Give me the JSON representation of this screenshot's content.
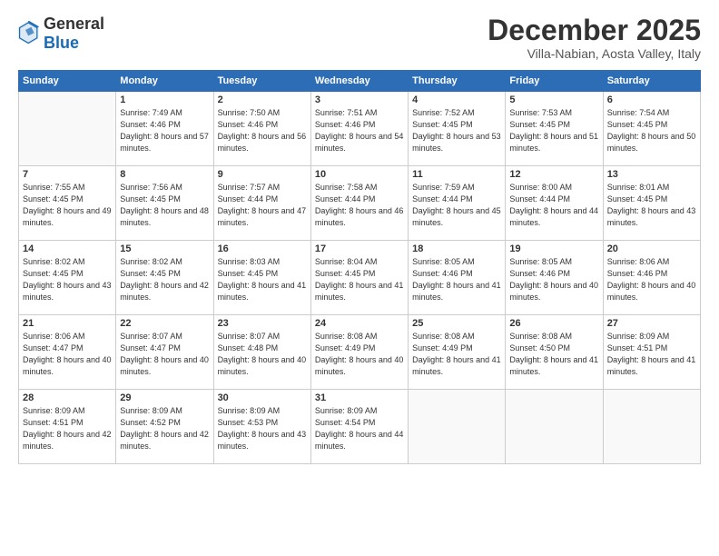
{
  "header": {
    "logo_general": "General",
    "logo_blue": "Blue",
    "month_title": "December 2025",
    "subtitle": "Villa-Nabian, Aosta Valley, Italy"
  },
  "days_of_week": [
    "Sunday",
    "Monday",
    "Tuesday",
    "Wednesday",
    "Thursday",
    "Friday",
    "Saturday"
  ],
  "weeks": [
    [
      {
        "day": "",
        "sunrise": "",
        "sunset": "",
        "daylight": ""
      },
      {
        "day": "1",
        "sunrise": "Sunrise: 7:49 AM",
        "sunset": "Sunset: 4:46 PM",
        "daylight": "Daylight: 8 hours and 57 minutes."
      },
      {
        "day": "2",
        "sunrise": "Sunrise: 7:50 AM",
        "sunset": "Sunset: 4:46 PM",
        "daylight": "Daylight: 8 hours and 56 minutes."
      },
      {
        "day": "3",
        "sunrise": "Sunrise: 7:51 AM",
        "sunset": "Sunset: 4:46 PM",
        "daylight": "Daylight: 8 hours and 54 minutes."
      },
      {
        "day": "4",
        "sunrise": "Sunrise: 7:52 AM",
        "sunset": "Sunset: 4:45 PM",
        "daylight": "Daylight: 8 hours and 53 minutes."
      },
      {
        "day": "5",
        "sunrise": "Sunrise: 7:53 AM",
        "sunset": "Sunset: 4:45 PM",
        "daylight": "Daylight: 8 hours and 51 minutes."
      },
      {
        "day": "6",
        "sunrise": "Sunrise: 7:54 AM",
        "sunset": "Sunset: 4:45 PM",
        "daylight": "Daylight: 8 hours and 50 minutes."
      }
    ],
    [
      {
        "day": "7",
        "sunrise": "Sunrise: 7:55 AM",
        "sunset": "Sunset: 4:45 PM",
        "daylight": "Daylight: 8 hours and 49 minutes."
      },
      {
        "day": "8",
        "sunrise": "Sunrise: 7:56 AM",
        "sunset": "Sunset: 4:45 PM",
        "daylight": "Daylight: 8 hours and 48 minutes."
      },
      {
        "day": "9",
        "sunrise": "Sunrise: 7:57 AM",
        "sunset": "Sunset: 4:44 PM",
        "daylight": "Daylight: 8 hours and 47 minutes."
      },
      {
        "day": "10",
        "sunrise": "Sunrise: 7:58 AM",
        "sunset": "Sunset: 4:44 PM",
        "daylight": "Daylight: 8 hours and 46 minutes."
      },
      {
        "day": "11",
        "sunrise": "Sunrise: 7:59 AM",
        "sunset": "Sunset: 4:44 PM",
        "daylight": "Daylight: 8 hours and 45 minutes."
      },
      {
        "day": "12",
        "sunrise": "Sunrise: 8:00 AM",
        "sunset": "Sunset: 4:44 PM",
        "daylight": "Daylight: 8 hours and 44 minutes."
      },
      {
        "day": "13",
        "sunrise": "Sunrise: 8:01 AM",
        "sunset": "Sunset: 4:45 PM",
        "daylight": "Daylight: 8 hours and 43 minutes."
      }
    ],
    [
      {
        "day": "14",
        "sunrise": "Sunrise: 8:02 AM",
        "sunset": "Sunset: 4:45 PM",
        "daylight": "Daylight: 8 hours and 43 minutes."
      },
      {
        "day": "15",
        "sunrise": "Sunrise: 8:02 AM",
        "sunset": "Sunset: 4:45 PM",
        "daylight": "Daylight: 8 hours and 42 minutes."
      },
      {
        "day": "16",
        "sunrise": "Sunrise: 8:03 AM",
        "sunset": "Sunset: 4:45 PM",
        "daylight": "Daylight: 8 hours and 41 minutes."
      },
      {
        "day": "17",
        "sunrise": "Sunrise: 8:04 AM",
        "sunset": "Sunset: 4:45 PM",
        "daylight": "Daylight: 8 hours and 41 minutes."
      },
      {
        "day": "18",
        "sunrise": "Sunrise: 8:05 AM",
        "sunset": "Sunset: 4:46 PM",
        "daylight": "Daylight: 8 hours and 41 minutes."
      },
      {
        "day": "19",
        "sunrise": "Sunrise: 8:05 AM",
        "sunset": "Sunset: 4:46 PM",
        "daylight": "Daylight: 8 hours and 40 minutes."
      },
      {
        "day": "20",
        "sunrise": "Sunrise: 8:06 AM",
        "sunset": "Sunset: 4:46 PM",
        "daylight": "Daylight: 8 hours and 40 minutes."
      }
    ],
    [
      {
        "day": "21",
        "sunrise": "Sunrise: 8:06 AM",
        "sunset": "Sunset: 4:47 PM",
        "daylight": "Daylight: 8 hours and 40 minutes."
      },
      {
        "day": "22",
        "sunrise": "Sunrise: 8:07 AM",
        "sunset": "Sunset: 4:47 PM",
        "daylight": "Daylight: 8 hours and 40 minutes."
      },
      {
        "day": "23",
        "sunrise": "Sunrise: 8:07 AM",
        "sunset": "Sunset: 4:48 PM",
        "daylight": "Daylight: 8 hours and 40 minutes."
      },
      {
        "day": "24",
        "sunrise": "Sunrise: 8:08 AM",
        "sunset": "Sunset: 4:49 PM",
        "daylight": "Daylight: 8 hours and 40 minutes."
      },
      {
        "day": "25",
        "sunrise": "Sunrise: 8:08 AM",
        "sunset": "Sunset: 4:49 PM",
        "daylight": "Daylight: 8 hours and 41 minutes."
      },
      {
        "day": "26",
        "sunrise": "Sunrise: 8:08 AM",
        "sunset": "Sunset: 4:50 PM",
        "daylight": "Daylight: 8 hours and 41 minutes."
      },
      {
        "day": "27",
        "sunrise": "Sunrise: 8:09 AM",
        "sunset": "Sunset: 4:51 PM",
        "daylight": "Daylight: 8 hours and 41 minutes."
      }
    ],
    [
      {
        "day": "28",
        "sunrise": "Sunrise: 8:09 AM",
        "sunset": "Sunset: 4:51 PM",
        "daylight": "Daylight: 8 hours and 42 minutes."
      },
      {
        "day": "29",
        "sunrise": "Sunrise: 8:09 AM",
        "sunset": "Sunset: 4:52 PM",
        "daylight": "Daylight: 8 hours and 42 minutes."
      },
      {
        "day": "30",
        "sunrise": "Sunrise: 8:09 AM",
        "sunset": "Sunset: 4:53 PM",
        "daylight": "Daylight: 8 hours and 43 minutes."
      },
      {
        "day": "31",
        "sunrise": "Sunrise: 8:09 AM",
        "sunset": "Sunset: 4:54 PM",
        "daylight": "Daylight: 8 hours and 44 minutes."
      },
      {
        "day": "",
        "sunrise": "",
        "sunset": "",
        "daylight": ""
      },
      {
        "day": "",
        "sunrise": "",
        "sunset": "",
        "daylight": ""
      },
      {
        "day": "",
        "sunrise": "",
        "sunset": "",
        "daylight": ""
      }
    ]
  ]
}
